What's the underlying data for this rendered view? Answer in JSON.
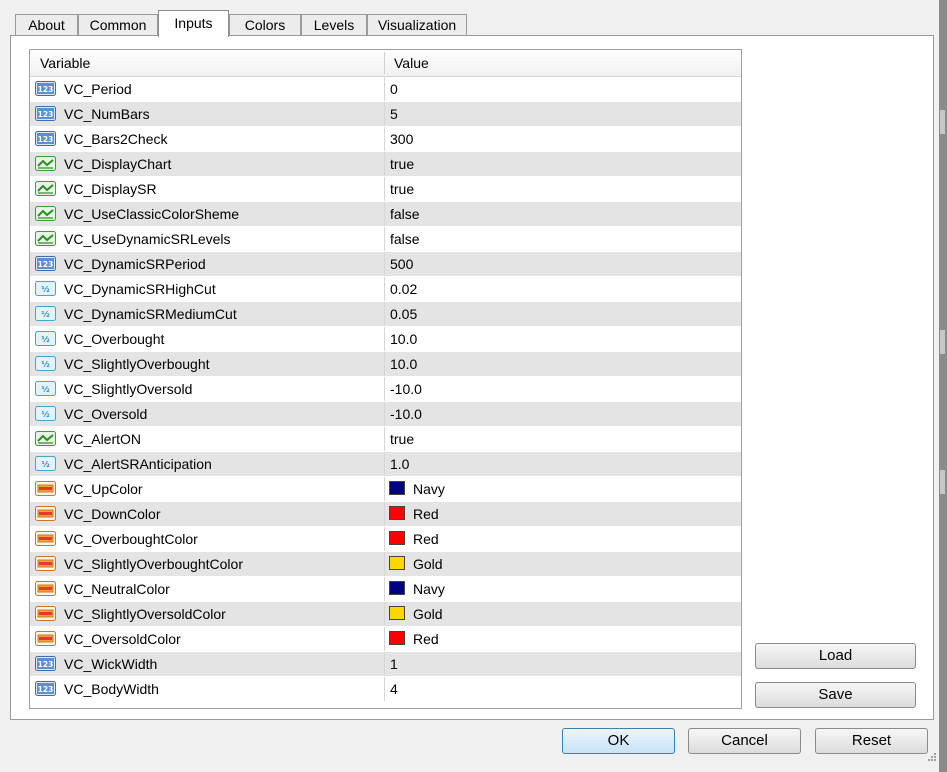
{
  "tabs": [
    {
      "label": "About",
      "active": false
    },
    {
      "label": "Common",
      "active": false
    },
    {
      "label": "Inputs",
      "active": true
    },
    {
      "label": "Colors",
      "active": false
    },
    {
      "label": "Levels",
      "active": false
    },
    {
      "label": "Visualization",
      "active": false
    }
  ],
  "grid": {
    "header": {
      "variable": "Variable",
      "value": "Value"
    },
    "rows": [
      {
        "icon": "int-icon",
        "name": "VC_Period",
        "value": "0"
      },
      {
        "icon": "int-icon",
        "name": "VC_NumBars",
        "value": "5"
      },
      {
        "icon": "int-icon",
        "name": "VC_Bars2Check",
        "value": "300"
      },
      {
        "icon": "bool-icon",
        "name": "VC_DisplayChart",
        "value": "true"
      },
      {
        "icon": "bool-icon",
        "name": "VC_DisplaySR",
        "value": "true"
      },
      {
        "icon": "bool-icon",
        "name": "VC_UseClassicColorSheme",
        "value": "false"
      },
      {
        "icon": "bool-icon",
        "name": "VC_UseDynamicSRLevels",
        "value": "false"
      },
      {
        "icon": "int-icon",
        "name": "VC_DynamicSRPeriod",
        "value": "500"
      },
      {
        "icon": "double-icon",
        "name": "VC_DynamicSRHighCut",
        "value": "0.02"
      },
      {
        "icon": "double-icon",
        "name": "VC_DynamicSRMediumCut",
        "value": "0.05"
      },
      {
        "icon": "double-icon",
        "name": "VC_Overbought",
        "value": "10.0"
      },
      {
        "icon": "double-icon",
        "name": "VC_SlightlyOverbought",
        "value": "10.0"
      },
      {
        "icon": "double-icon",
        "name": "VC_SlightlyOversold",
        "value": "-10.0"
      },
      {
        "icon": "double-icon",
        "name": "VC_Oversold",
        "value": "-10.0"
      },
      {
        "icon": "bool-icon",
        "name": "VC_AlertON",
        "value": "true"
      },
      {
        "icon": "double-icon",
        "name": "VC_AlertSRAnticipation",
        "value": "1.0"
      },
      {
        "icon": "color-icon",
        "name": "VC_UpColor",
        "value": "Navy",
        "swatch": "#000080"
      },
      {
        "icon": "color-icon",
        "name": "VC_DownColor",
        "value": "Red",
        "swatch": "#ff0000"
      },
      {
        "icon": "color-icon",
        "name": "VC_OverboughtColor",
        "value": "Red",
        "swatch": "#ff0000"
      },
      {
        "icon": "color-icon",
        "name": "VC_SlightlyOverboughtColor",
        "value": "Gold",
        "swatch": "#ffd700"
      },
      {
        "icon": "color-icon",
        "name": "VC_NeutralColor",
        "value": "Navy",
        "swatch": "#000080"
      },
      {
        "icon": "color-icon",
        "name": "VC_SlightlyOversoldColor",
        "value": "Gold",
        "swatch": "#ffd700"
      },
      {
        "icon": "color-icon",
        "name": "VC_OversoldColor",
        "value": "Red",
        "swatch": "#ff0000"
      },
      {
        "icon": "int-icon",
        "name": "VC_WickWidth",
        "value": "1"
      },
      {
        "icon": "int-icon",
        "name": "VC_BodyWidth",
        "value": "4"
      }
    ]
  },
  "buttons": {
    "load": "Load",
    "save": "Save",
    "ok": "OK",
    "cancel": "Cancel",
    "reset": "Reset"
  }
}
